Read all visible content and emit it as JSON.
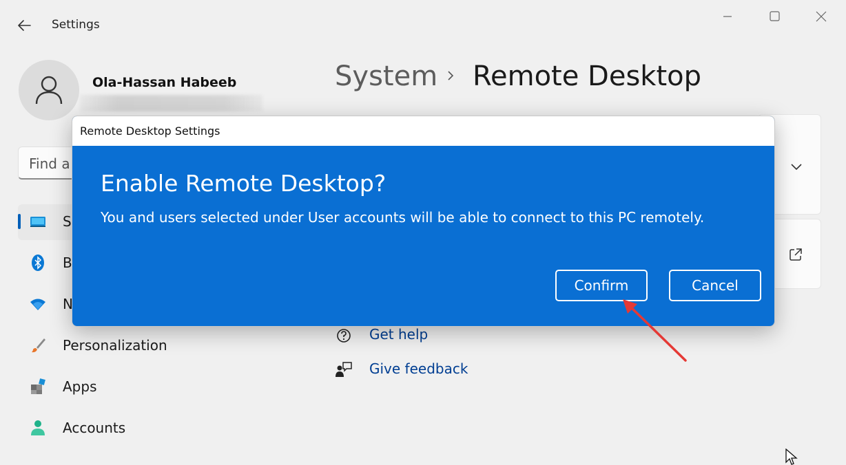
{
  "window": {
    "title": "Settings",
    "back_icon": "arrow-left-icon",
    "controls": [
      "minimize-icon",
      "maximize-icon",
      "close-icon"
    ]
  },
  "user": {
    "name": "Ola-Hassan Habeeb",
    "avatar_icon": "person-icon"
  },
  "search": {
    "placeholder": "Find a"
  },
  "sidebar": {
    "items": [
      {
        "label": "Sy",
        "icon": "monitor-icon",
        "selected": true
      },
      {
        "label": "B",
        "icon": "bluetooth-icon",
        "selected": false
      },
      {
        "label": "N",
        "icon": "wifi-icon",
        "selected": false
      },
      {
        "label": "Personalization",
        "icon": "paintbrush-icon",
        "selected": false
      },
      {
        "label": "Apps",
        "icon": "apps-icon",
        "selected": false
      },
      {
        "label": "Accounts",
        "icon": "account-icon",
        "selected": false
      }
    ]
  },
  "breadcrumb": {
    "parent": "System",
    "current": "Remote Desktop"
  },
  "links": {
    "get_help": "Get help",
    "give_feedback": "Give feedback"
  },
  "dialog": {
    "window_title": "Remote Desktop Settings",
    "heading": "Enable Remote Desktop?",
    "message": "You and users selected under User accounts will be able to connect to this PC remotely.",
    "confirm_label": "Confirm",
    "cancel_label": "Cancel"
  },
  "colors": {
    "dialog_blue": "#0a6fd3",
    "accent": "#005fb8",
    "link": "#003e92",
    "annotation_arrow": "#e53935"
  }
}
